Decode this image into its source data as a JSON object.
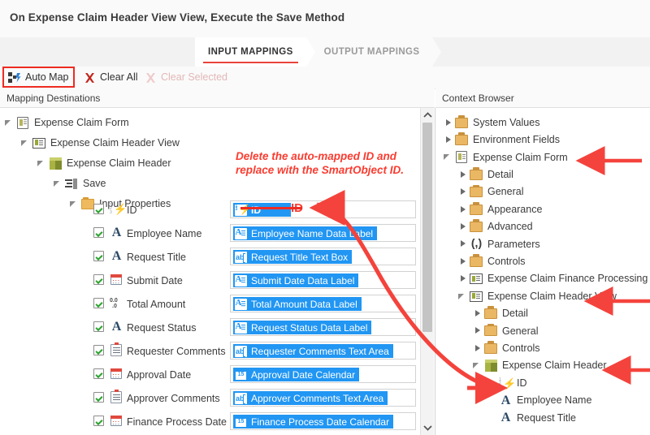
{
  "window": {
    "title": "On Expense Claim Header View View, Execute the Save Method"
  },
  "tabs": [
    {
      "label": "INPUT MAPPINGS",
      "active": true
    },
    {
      "label": "OUTPUT MAPPINGS",
      "active": false
    }
  ],
  "toolbar": {
    "auto_map_label": "Auto Map",
    "clear_all_label": "Clear All",
    "clear_selected_label": "Clear Selected",
    "clear_selected_disabled": true,
    "highlight_color": "#ee2b22"
  },
  "columns": {
    "left_header": "Mapping Destinations",
    "right_header": "Context Browser"
  },
  "mapping_destinations": {
    "tree": [
      {
        "label": "Expense Claim Form",
        "icon": "form-icon",
        "depth": 0,
        "expander": "open"
      },
      {
        "label": "Expense Claim Header View",
        "icon": "view-icon",
        "depth": 1,
        "expander": "open"
      },
      {
        "label": "Expense Claim Header",
        "icon": "smartobject-icon",
        "depth": 2,
        "expander": "open"
      },
      {
        "label": "Save",
        "icon": "method-icon",
        "depth": 3,
        "expander": "open"
      },
      {
        "label": "Input Properties",
        "icon": "folder-icon",
        "depth": 4,
        "expander": "open"
      }
    ],
    "rows": [
      {
        "name": "ID",
        "icon": "autonumber-icon",
        "checked": true,
        "value": "ID",
        "value_icon": "id-icon",
        "struck_through": true
      },
      {
        "name": "Employee Name",
        "icon": "text-icon",
        "checked": true,
        "value": "Employee Name Data Label",
        "value_icon": "data-label-icon",
        "struck_through": false
      },
      {
        "name": "Request Title",
        "icon": "text-icon",
        "checked": true,
        "value": "Request Title Text Box",
        "value_icon": "text-box-icon",
        "struck_through": false
      },
      {
        "name": "Submit Date",
        "icon": "calendar-icon",
        "checked": true,
        "value": "Submit Date Data Label",
        "value_icon": "data-label-icon",
        "struck_through": false
      },
      {
        "name": "Total Amount",
        "icon": "decimal-icon",
        "checked": true,
        "value": "Total Amount Data Label",
        "value_icon": "data-label-icon",
        "struck_through": false
      },
      {
        "name": "Request Status",
        "icon": "text-icon",
        "checked": true,
        "value": "Request Status Data Label",
        "value_icon": "data-label-icon",
        "struck_through": false
      },
      {
        "name": "Requester Comments",
        "icon": "memo-icon",
        "checked": true,
        "value": "Requester Comments Text Area",
        "value_icon": "text-box-icon",
        "struck_through": false
      },
      {
        "name": "Approval Date",
        "icon": "calendar-icon",
        "checked": true,
        "value": "Approval Date Calendar",
        "value_icon": "calendar-control-icon",
        "struck_through": false
      },
      {
        "name": "Approver Comments",
        "icon": "memo-icon",
        "checked": true,
        "value": "Approver Comments Text Area",
        "value_icon": "text-box-icon",
        "struck_through": false
      },
      {
        "name": "Finance Process Date",
        "icon": "calendar-icon",
        "checked": true,
        "value": "Finance Process Date Calendar",
        "value_icon": "calendar-control-icon",
        "struck_through": false
      }
    ]
  },
  "context_browser": {
    "items": [
      {
        "label": "System Values",
        "icon": "folder-icon",
        "depth": 0,
        "expander": "closed",
        "arrow": false
      },
      {
        "label": "Environment Fields",
        "icon": "folder-icon",
        "depth": 0,
        "expander": "closed",
        "arrow": false
      },
      {
        "label": "Expense Claim Form",
        "icon": "form-icon",
        "depth": 0,
        "expander": "open",
        "arrow": true
      },
      {
        "label": "Detail",
        "icon": "folder-icon",
        "depth": 1,
        "expander": "closed",
        "arrow": false
      },
      {
        "label": "General",
        "icon": "folder-icon",
        "depth": 1,
        "expander": "closed",
        "arrow": false
      },
      {
        "label": "Appearance",
        "icon": "folder-icon",
        "depth": 1,
        "expander": "closed",
        "arrow": false
      },
      {
        "label": "Advanced",
        "icon": "folder-icon",
        "depth": 1,
        "expander": "closed",
        "arrow": false
      },
      {
        "label": "Parameters",
        "icon": "parameters-icon",
        "depth": 1,
        "expander": "closed",
        "arrow": false
      },
      {
        "label": "Controls",
        "icon": "folder-icon",
        "depth": 1,
        "expander": "closed",
        "arrow": false
      },
      {
        "label": "Expense Claim Finance Processing V",
        "icon": "view-icon",
        "depth": 1,
        "expander": "closed",
        "arrow": false
      },
      {
        "label": "Expense Claim Header View",
        "icon": "view-icon",
        "depth": 1,
        "expander": "open",
        "arrow": true
      },
      {
        "label": "Detail",
        "icon": "folder-icon",
        "depth": 2,
        "expander": "closed",
        "arrow": false
      },
      {
        "label": "General",
        "icon": "folder-icon",
        "depth": 2,
        "expander": "closed",
        "arrow": false
      },
      {
        "label": "Controls",
        "icon": "folder-icon",
        "depth": 2,
        "expander": "closed",
        "arrow": false
      },
      {
        "label": "Expense Claim Header",
        "icon": "smartobject-icon",
        "depth": 2,
        "expander": "open",
        "arrow": true
      },
      {
        "label": "ID",
        "icon": "autonumber-icon",
        "depth": 3,
        "expander": "none",
        "arrow": false
      },
      {
        "label": "Employee Name",
        "icon": "text-icon",
        "depth": 3,
        "expander": "none",
        "arrow": false
      },
      {
        "label": "Request Title",
        "icon": "text-icon",
        "depth": 3,
        "expander": "none",
        "arrow": false
      }
    ]
  },
  "annotations": {
    "note": "Delete the auto-mapped ID and replace with the SmartObject ID.",
    "id_callout": "ID",
    "color": "#fa3c30"
  },
  "colors": {
    "chip_blue": "#2196f3",
    "accent_red": "#e8433a",
    "check_green": "#2fa331"
  }
}
